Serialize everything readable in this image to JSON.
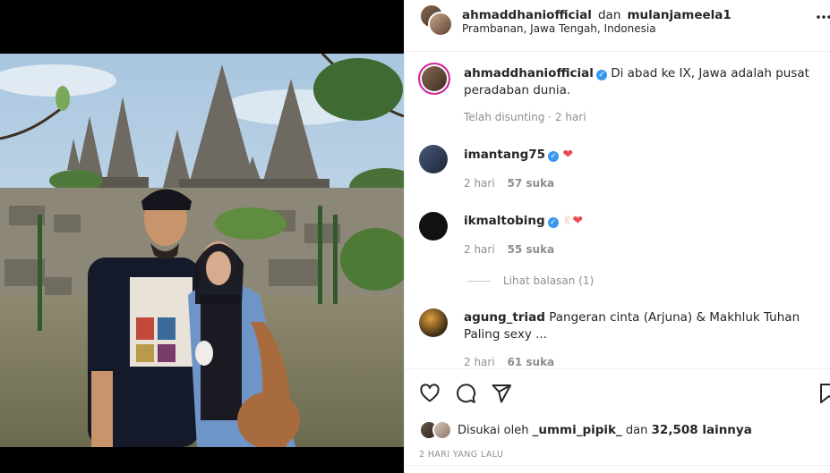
{
  "header": {
    "username": "ahmaddhaniofficial",
    "connector": "dan",
    "collaborator": "mulanjameela1",
    "location": "Prambanan, Jawa Tengah, Indonesia",
    "more_icon": "more-horizontal-icon"
  },
  "caption": {
    "username": "ahmaddhaniofficial",
    "text": "Di abad ke IX, Jawa adalah pusat peradaban dunia.",
    "meta": "Telah disunting · 2 hari"
  },
  "comments": [
    {
      "username": "imantang75",
      "emoji": "❤",
      "time": "2 hari",
      "likes": "57 suka"
    },
    {
      "username": "ikmaltobing",
      "emoji_hand": "✌",
      "emoji": "❤",
      "time": "2 hari",
      "likes": "55 suka"
    },
    {
      "username": "agung_triad",
      "text": "Pangeran cinta (Arjuna) & Makhluk Tuhan Paling sexy ...",
      "time": "2 hari",
      "likes": "61 suka"
    }
  ],
  "replies": {
    "label": "Lihat balasan (1)"
  },
  "actions": {
    "like_icon": "heart-outline-icon",
    "comment_icon": "comment-icon",
    "share_icon": "send-icon",
    "save_icon": "bookmark-icon"
  },
  "likes": {
    "prefix": "Disukai oleh",
    "user": "_ummi_pipik_",
    "connector": "dan",
    "others": "32,508 lainnya"
  },
  "timestamp": "2 HARI YANG LALU",
  "colors": {
    "verified": "#3897f0",
    "heart": "#ed4956",
    "muted": "#8e8e8e"
  }
}
